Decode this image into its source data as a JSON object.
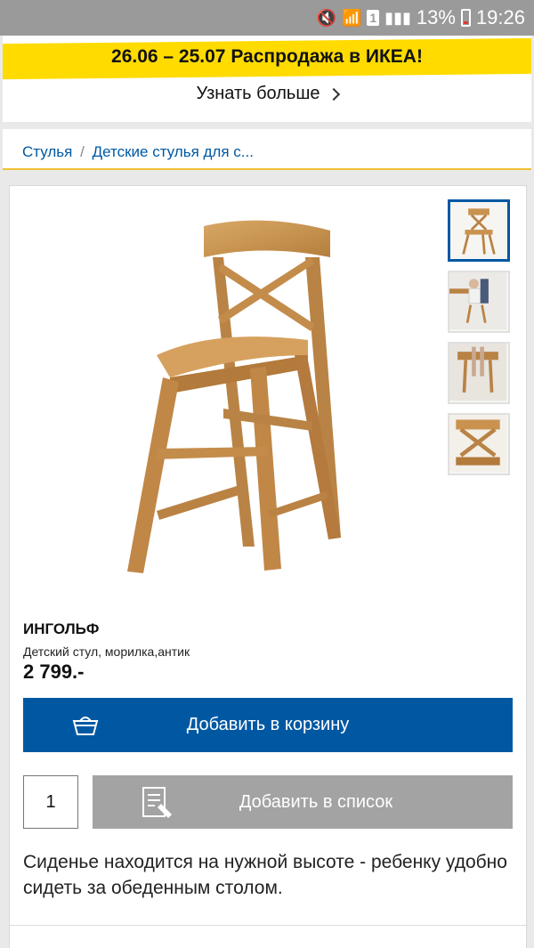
{
  "status_bar": {
    "battery_percent": "13%",
    "time": "19:26",
    "sim_label": "1"
  },
  "promo": {
    "title": "26.06 – 25.07 Распродажа в ИКЕА!",
    "link_label": "Узнать больше",
    "accent_color": "#ffdb00"
  },
  "breadcrumb": {
    "items": [
      "Стулья",
      "Детские стулья для с..."
    ],
    "separator": "/"
  },
  "product": {
    "name": "ИНГОЛЬФ",
    "description": "Детский стул, морилка,антик",
    "price": "2 799.-",
    "add_to_cart_label": "Добавить в корзину",
    "quantity": "1",
    "add_to_list_label": "Добавить в список",
    "body_text": "Сиденье находится на нужной высоте - ребенку удобно сидеть за обеденным столом.",
    "thumbnails": [
      "thumb-chair-front",
      "thumb-chair-in-use",
      "thumb-chair-legs",
      "thumb-chair-back"
    ],
    "brand_color": "#0058a3"
  }
}
